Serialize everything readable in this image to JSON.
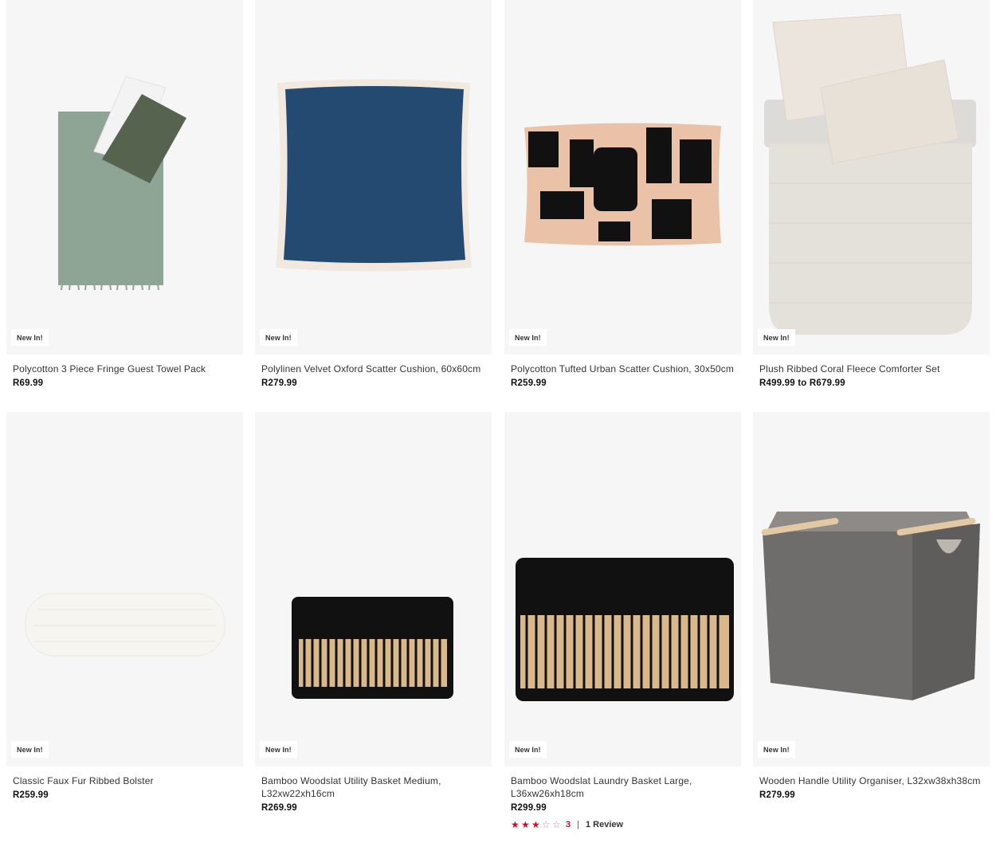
{
  "products": [
    {
      "badge": "New In!",
      "title": "Polycotton 3 Piece Fringe Guest Towel Pack",
      "price": "R69.99",
      "image_icon": "towel-pack-image"
    },
    {
      "badge": "New In!",
      "title": "Polylinen Velvet Oxford Scatter Cushion, 60x60cm",
      "price": "R279.99",
      "image_icon": "velvet-cushion-image"
    },
    {
      "badge": "New In!",
      "title": "Polycotton Tufted Urban Scatter Cushion, 30x50cm",
      "price": "R259.99",
      "image_icon": "tufted-cushion-image"
    },
    {
      "badge": "New In!",
      "title": "Plush Ribbed Coral Fleece Comforter Set",
      "price": "R499.99 to R679.99",
      "image_icon": "comforter-set-image"
    },
    {
      "badge": "New In!",
      "title": "Classic Faux Fur Ribbed Bolster",
      "price": "R259.99",
      "image_icon": "bolster-image"
    },
    {
      "badge": "New In!",
      "title": "Bamboo Woodslat Utility Basket Medium, L32xw22xh16cm",
      "price": "R269.99",
      "image_icon": "bamboo-basket-medium-image"
    },
    {
      "badge": "New In!",
      "title": "Bamboo Woodslat Laundry Basket Large, L36xw26xh18cm",
      "price": "R299.99",
      "image_icon": "bamboo-basket-large-image",
      "rating": {
        "stars": 3,
        "max": 5,
        "count_label": "3",
        "separator": "|",
        "reviews_label": "1 Review"
      }
    },
    {
      "badge": "New In!",
      "title": "Wooden Handle Utility Organiser, L32xw38xh38cm",
      "price": "R279.99",
      "image_icon": "utility-organiser-image"
    }
  ],
  "colors": {
    "image_bg": "#f6f6f6",
    "rating_accent": "#c8102e"
  }
}
